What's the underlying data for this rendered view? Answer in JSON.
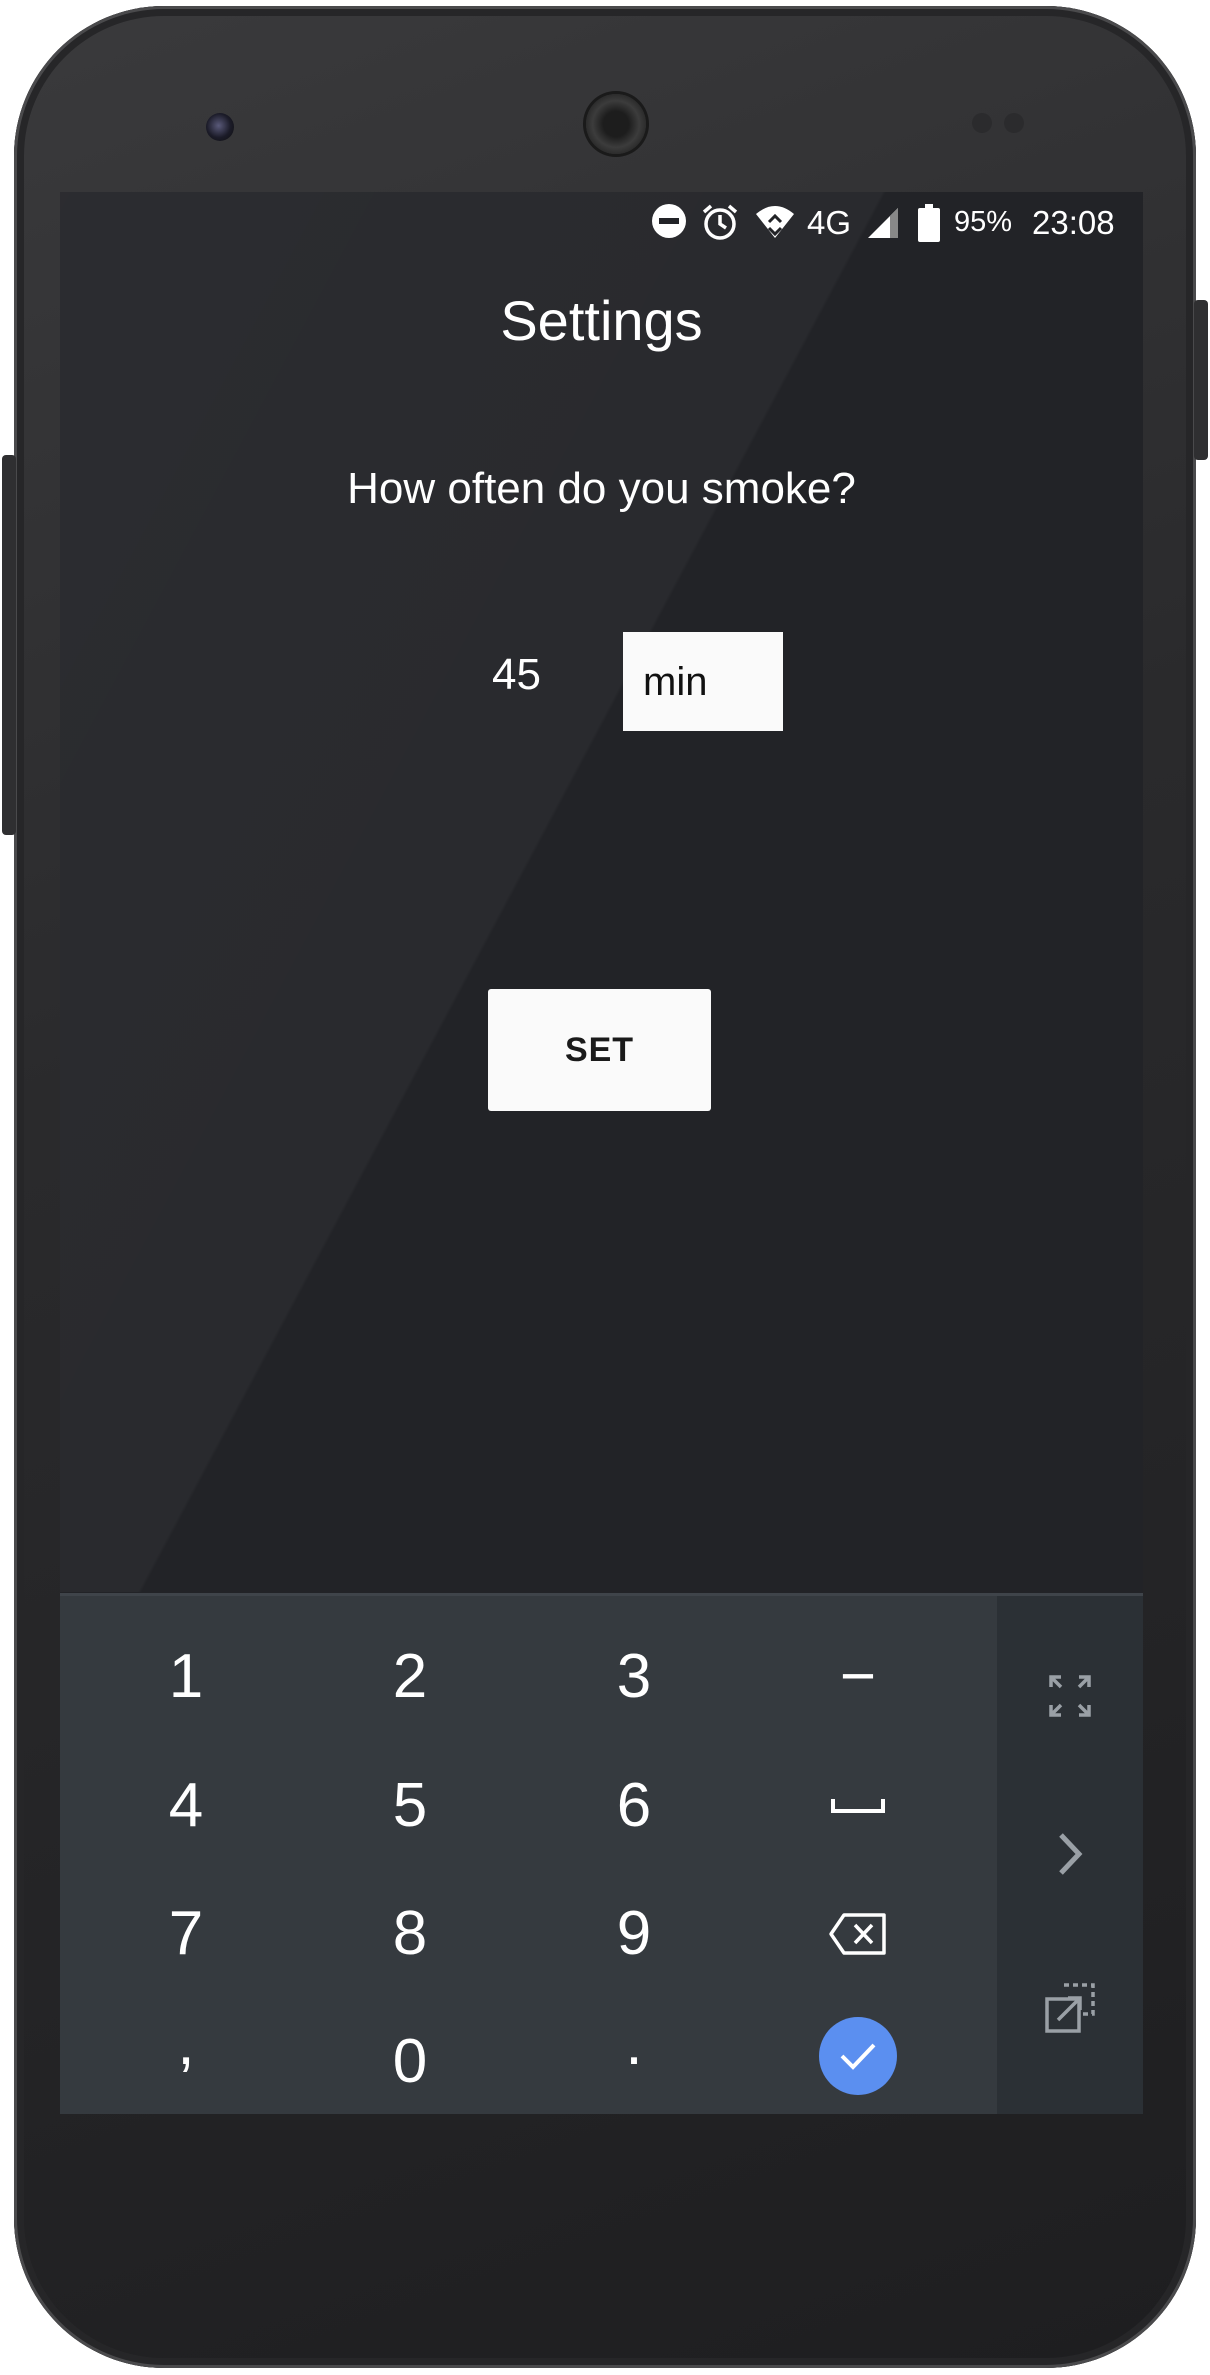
{
  "status_bar": {
    "battery_percent": "95%",
    "network": "4G",
    "time": "23:08",
    "icons": [
      "do-not-disturb-icon",
      "alarm-icon",
      "wifi-icon",
      "signal-icon",
      "battery-icon"
    ]
  },
  "screen": {
    "title": "Settings",
    "question": "How often do you smoke?",
    "amount_value": "45",
    "unit_selected": "min",
    "set_button": "SET"
  },
  "keyboard": {
    "row1": [
      "1",
      "2",
      "3",
      "−"
    ],
    "row2": [
      "4",
      "5",
      "6"
    ],
    "row3": [
      "7",
      "8",
      "9"
    ],
    "row4": [
      ",",
      "0",
      "."
    ],
    "special_icons": [
      "space-icon",
      "backspace-icon",
      "done-check-icon"
    ],
    "side_icons": [
      "fullscreen-icon",
      "chevron-right-icon",
      "floating-keyboard-icon"
    ],
    "accent_color": "#5b8ff0",
    "background_color": "#353a3f"
  },
  "colors": {
    "screen_background": "#222327",
    "button_background": "#fafafa"
  }
}
